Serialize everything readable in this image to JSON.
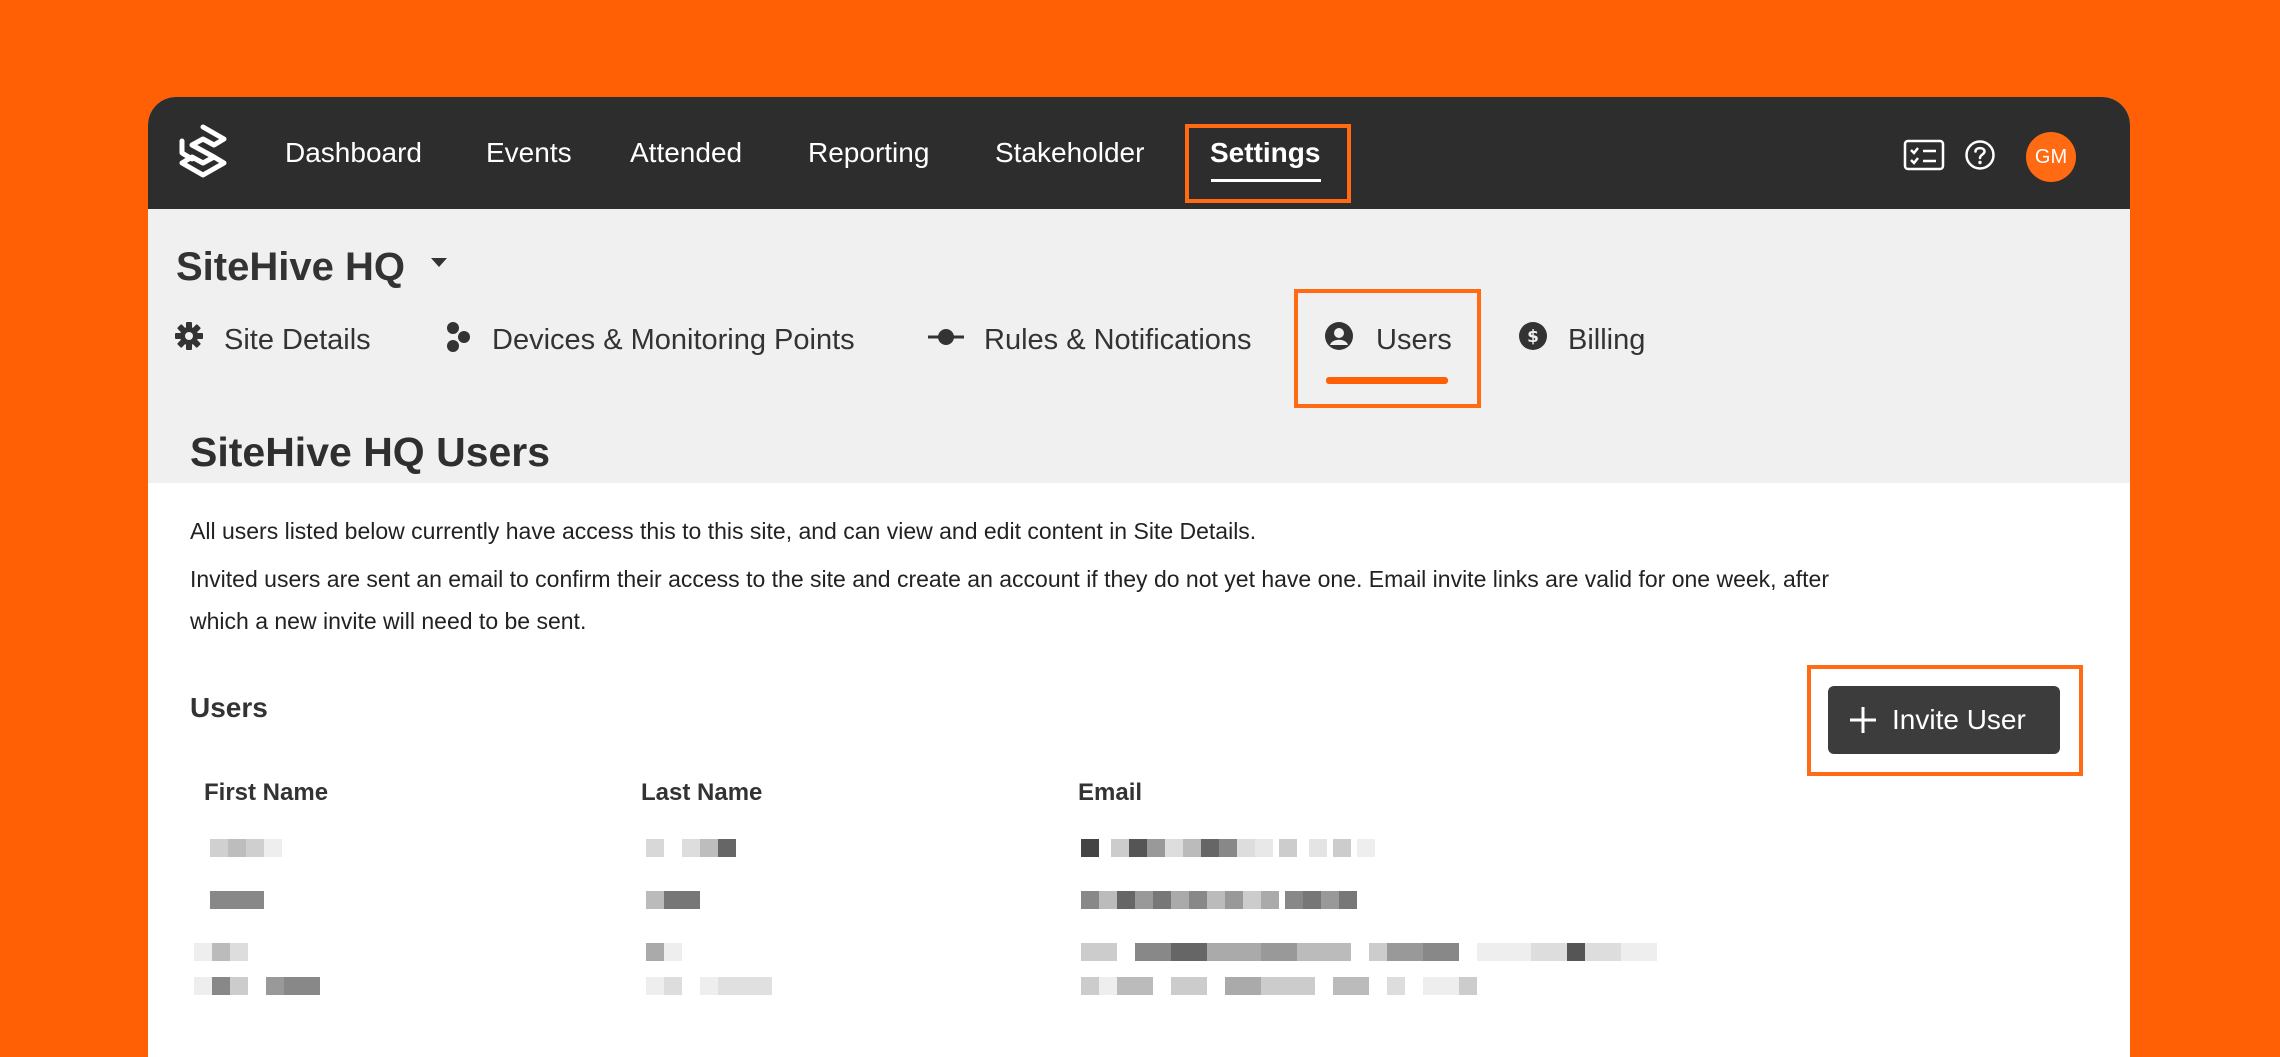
{
  "brand": {
    "logo_icon": "sitehive-logo-icon"
  },
  "nav": {
    "items": [
      {
        "label": "Dashboard"
      },
      {
        "label": "Events"
      },
      {
        "label": "Attended"
      },
      {
        "label": "Reporting"
      },
      {
        "label": "Stakeholder"
      },
      {
        "label": "Settings",
        "active": true
      }
    ]
  },
  "top_icons": [
    "checklist-icon",
    "help-icon"
  ],
  "user": {
    "initials": "GM"
  },
  "site": {
    "name": "SiteHive HQ"
  },
  "tabs": [
    {
      "label": "Site Details",
      "icon": "gear-icon"
    },
    {
      "label": "Devices & Monitoring Points",
      "icon": "devices-icon"
    },
    {
      "label": "Rules & Notifications",
      "icon": "rule-icon"
    },
    {
      "label": "Users",
      "icon": "user-circle-icon",
      "active": true
    },
    {
      "label": "Billing",
      "icon": "dollar-circle-icon"
    }
  ],
  "page": {
    "title": "SiteHive HQ Users",
    "intro_1": "All users listed below currently have access this to this site, and can view and edit content in Site Details.",
    "intro_2a": "Invited users are sent an email to confirm their access to the site and create an account if they do not yet have one. Email invite links are valid for one week, after",
    "intro_2b": "which a new invite will need to be sent."
  },
  "users_section": {
    "title": "Users",
    "invite_label": "Invite User",
    "columns": [
      "First Name",
      "Last Name",
      "Email"
    ]
  },
  "colors": {
    "background": "#ff5f05",
    "accent": "#ff6a13",
    "topbar": "#2d2d2d",
    "button": "#3c3c3c"
  }
}
